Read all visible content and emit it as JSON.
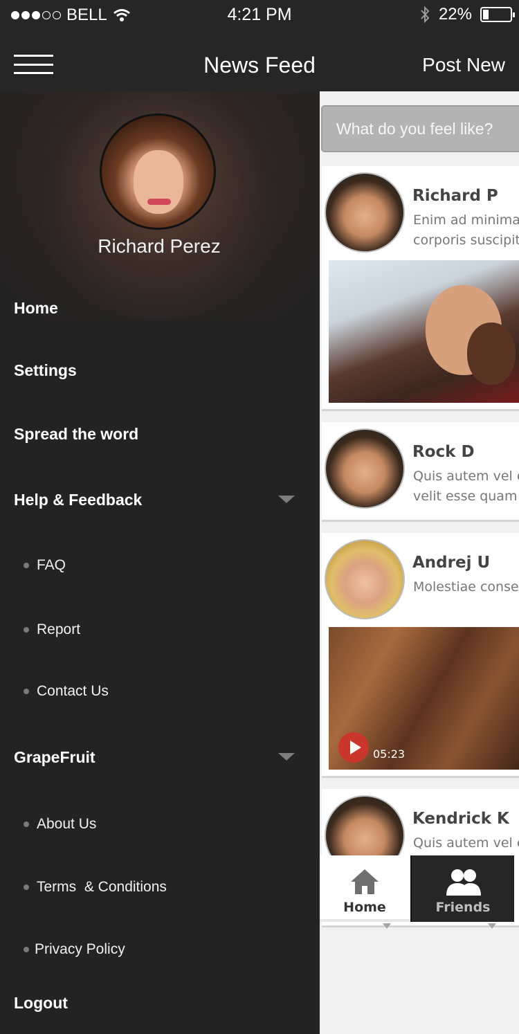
{
  "status_bar": {
    "carrier": "BELL",
    "time": "4:21 PM",
    "battery": "22%",
    "battery_level": 0.22
  },
  "nav": {
    "title": "News Feed",
    "post_new": "Post New"
  },
  "drawer": {
    "profile_name": "Richard Perez",
    "menu": {
      "home": "Home",
      "settings": "Settings",
      "spread": "Spread the word",
      "help": "Help & Feedback",
      "faq": "FAQ",
      "report": "Report",
      "contact": "Contact Us",
      "grapefruit": "GrapeFruit",
      "about": "About Us",
      "terms": "Terms  & Conditions",
      "privacy": "Privacy Policy",
      "logout": "Logout"
    }
  },
  "feed": {
    "placeholder": "What do you feel like?",
    "posts": [
      {
        "name": "Richard P",
        "line1": "Enim ad minima",
        "line2": "corporis suscipit"
      },
      {
        "name": "Rock D",
        "line1": "Quis autem vel e",
        "line2": "velit esse quam n"
      },
      {
        "name": "Andrej U",
        "line1": "Molestiae consec",
        "video_time": "05:23"
      },
      {
        "name": "Kendrick K",
        "line1": "Quis autem vel e"
      }
    ]
  },
  "tabs": {
    "home": "Home",
    "friends": "Friends"
  },
  "colors": {
    "dark": "#232323",
    "accent_play": "#c8362c",
    "input_gray": "#b3b3b3"
  }
}
